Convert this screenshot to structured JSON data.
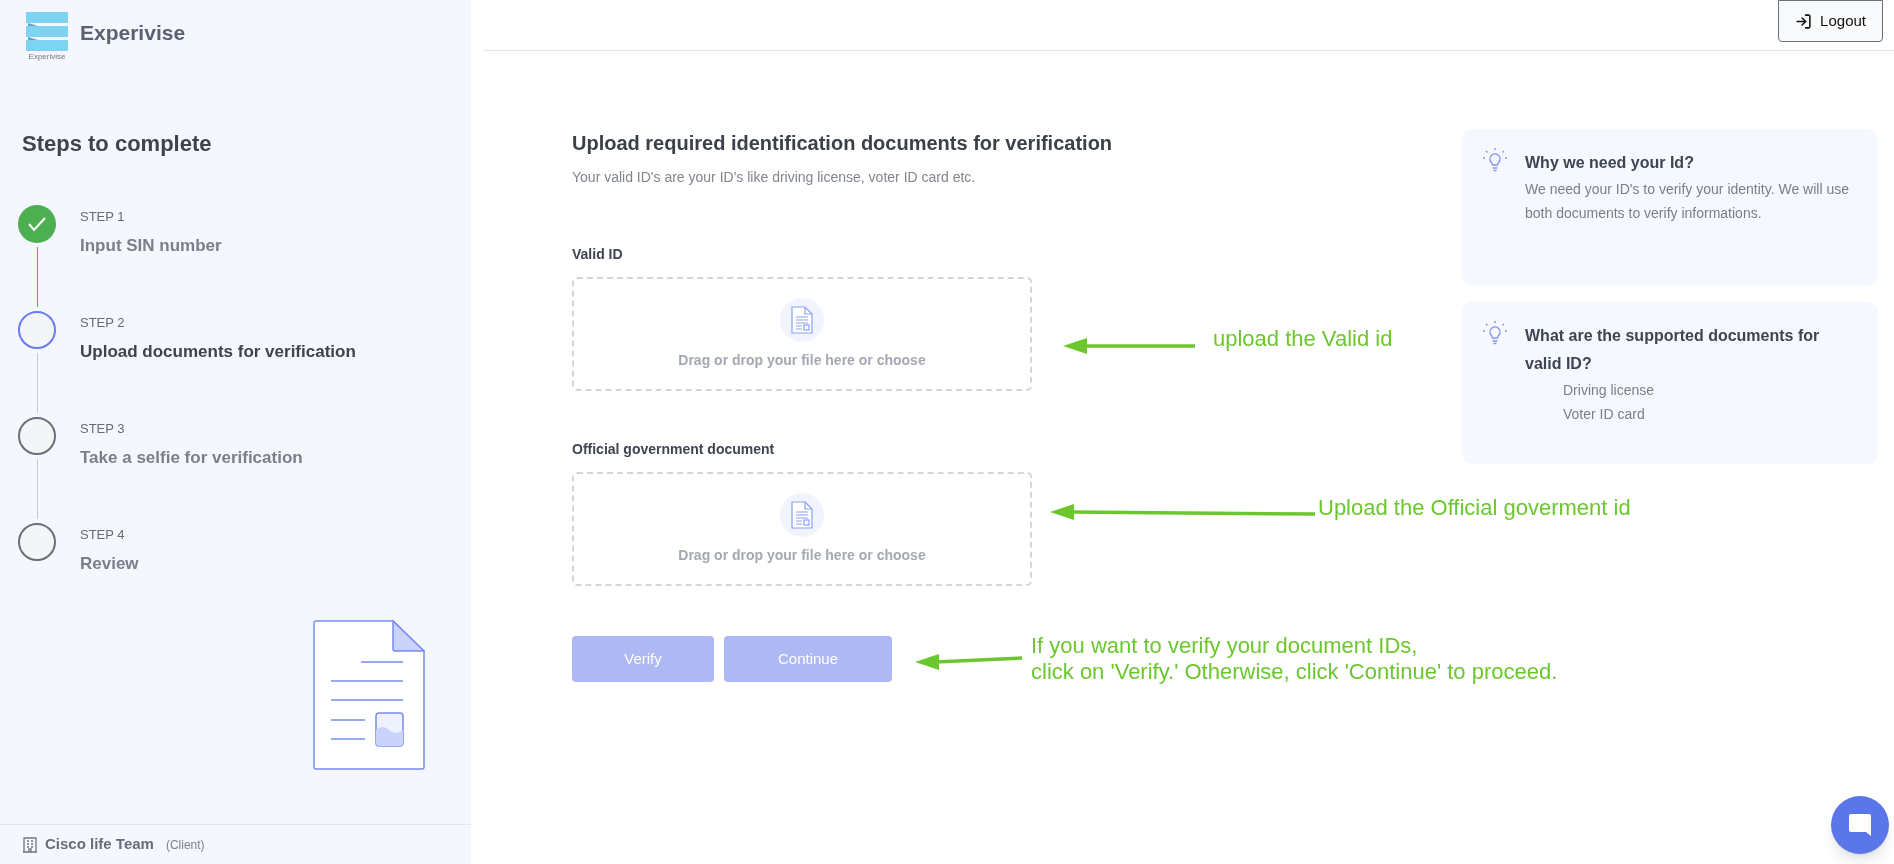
{
  "brand": {
    "name": "Experivise",
    "logo_caption": "Experivise"
  },
  "sidebar": {
    "title": "Steps to complete",
    "steps": [
      {
        "label": "STEP 1",
        "title": "Input SIN number",
        "completed": true,
        "selected": false
      },
      {
        "label": "STEP 2",
        "title": "Upload documents for verification",
        "completed": false,
        "selected": true
      },
      {
        "label": "STEP 3",
        "title": "Take a selfie for verification",
        "completed": false,
        "selected": false
      },
      {
        "label": "STEP 4",
        "title": "Review",
        "completed": false,
        "selected": false
      }
    ],
    "footer": {
      "team": "Cisco life Team",
      "role": "(Client)"
    }
  },
  "header": {
    "logout": "Logout"
  },
  "main": {
    "title": "Upload required identification documents for verification",
    "subtitle": "Your valid ID's are your ID's like driving license, voter ID card etc.",
    "uploads": [
      {
        "label": "Valid ID",
        "hint": "Drag or drop your file here or choose"
      },
      {
        "label": "Official government document",
        "hint": "Drag or drop your file here or choose"
      }
    ],
    "buttons": [
      {
        "label": "Verify",
        "disabled": true
      },
      {
        "label": "Continue",
        "disabled": true
      }
    ]
  },
  "info_cards": [
    {
      "title": "Why we need your Id?",
      "body": "We need your ID's to verify your identity. We will use both documents to verify informations."
    },
    {
      "title": "What are the supported documents for valid ID?",
      "items": [
        "Driving license",
        "Voter ID card"
      ]
    }
  ],
  "annotations": [
    {
      "lines": [
        "upload the Valid id"
      ]
    },
    {
      "lines": [
        "Upload the Official goverment id"
      ]
    },
    {
      "lines": [
        "If you want to verify your document IDs,",
        "click on 'Verify.' Otherwise, click 'Continue' to proceed."
      ]
    }
  ]
}
